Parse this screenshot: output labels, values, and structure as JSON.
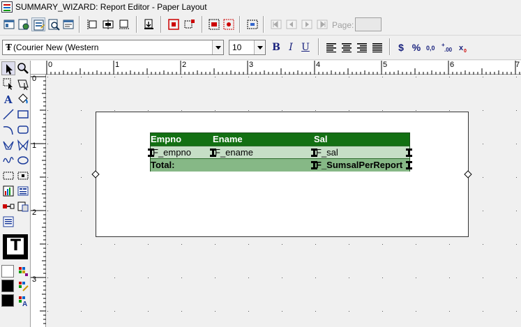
{
  "window": {
    "title": "SUMMARY_WIZARD: Report Editor - Paper Layout"
  },
  "toolbar": {
    "page_label": "Page:",
    "page_value": ""
  },
  "format_bar": {
    "font_name": "(Courier New (Western",
    "font_size": "10",
    "bold_label": "B",
    "italic_label": "I",
    "underline_label": "U",
    "currency_label": "$",
    "percent_label": "%"
  },
  "rulers": {
    "horizontal": [
      "0",
      "1",
      "2",
      "3",
      "4",
      "5",
      "6",
      "7"
    ],
    "vertical": [
      "0",
      "1",
      "2",
      "3"
    ]
  },
  "report": {
    "headers": [
      "Empno",
      "Ename",
      "Sal"
    ],
    "fields": [
      "F_empno",
      "F_ename",
      "F_sal"
    ],
    "total_label": "Total:",
    "total_field": "F_SumsalPerReport"
  },
  "colors": {
    "header_bg": "#137013",
    "data_bg": "#c6dec6",
    "total_bg": "#86b886"
  }
}
